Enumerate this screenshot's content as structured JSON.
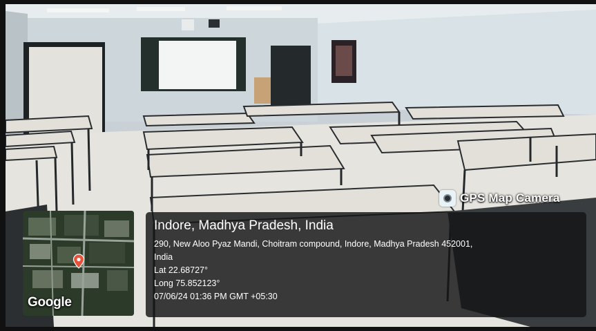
{
  "watermark": {
    "label": "GPS Map Camera",
    "icon": "camera-icon"
  },
  "location": {
    "city_line": "Indore, Madhya Pradesh, India",
    "address_line1": "290, New Aloo Pyaz Mandi, Choitram compound, Indore, Madhya Pradesh 452001,",
    "address_line2": "India",
    "latitude": "Lat 22.68727°",
    "longitude": "Long 75.852123°",
    "timestamp": "07/06/24 01:36 PM GMT +05:30"
  },
  "map": {
    "brand": "Google",
    "pin_icon": "map-pin-icon"
  },
  "colors": {
    "panel": "#141618",
    "pin": "#e5533a",
    "wall": "#cfd8dd",
    "floor": "#e8e6e0"
  }
}
